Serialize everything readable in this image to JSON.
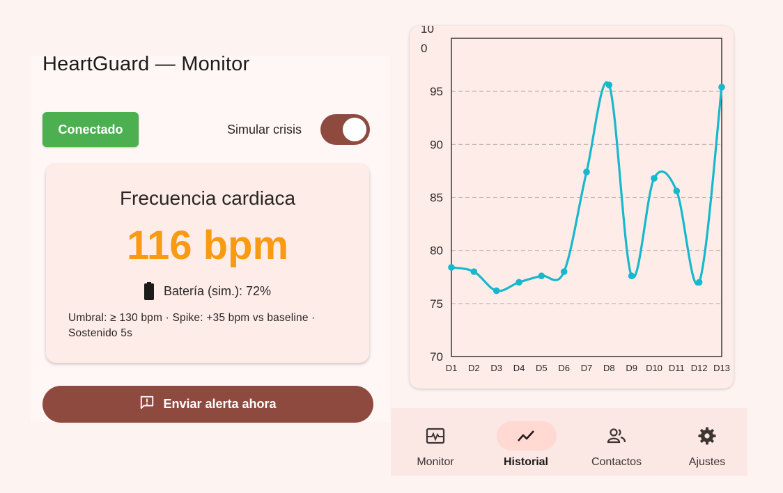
{
  "app": {
    "title": "HeartGuard — Monitor"
  },
  "status": {
    "label": "Conectado",
    "color": "#4caf50"
  },
  "crisis_toggle": {
    "label": "Simular crisis",
    "on": true
  },
  "heart_rate": {
    "title": "Frecuencia cardiaca",
    "value": "116 bpm",
    "value_color": "#f89a12",
    "battery_label": "Batería (sim.): 72%",
    "battery_icon": "battery-icon",
    "info": "Umbral: ≥ 130 bpm · Spike: +35 bpm vs baseline · Sostenido 5s"
  },
  "alert_button": {
    "label": "Enviar alerta ahora",
    "icon": "alert-message-icon"
  },
  "chart_data": {
    "type": "line",
    "categories": [
      "D1",
      "D2",
      "D3",
      "D4",
      "D5",
      "D6",
      "D7",
      "D8",
      "D9",
      "D10",
      "D11",
      "D12",
      "D13"
    ],
    "values": [
      78.4,
      78.0,
      76.2,
      77.0,
      77.6,
      78.0,
      87.4,
      95.6,
      77.6,
      86.8,
      85.6,
      77.0,
      95.4
    ],
    "y_ticks": [
      "70",
      "75",
      "80",
      "85",
      "90",
      "95",
      "10\n0"
    ],
    "ylim": [
      70,
      100
    ],
    "grid": "horizontal-dashed",
    "line_color": "#17b8cc"
  },
  "nav": {
    "items": [
      {
        "label": "Monitor",
        "icon": "monitor-heart-icon",
        "active": false
      },
      {
        "label": "Historial",
        "icon": "trending-up-icon",
        "active": true
      },
      {
        "label": "Contactos",
        "icon": "contacts-icon",
        "active": false
      },
      {
        "label": "Ajustes",
        "icon": "settings-gear-icon",
        "active": false
      }
    ]
  }
}
